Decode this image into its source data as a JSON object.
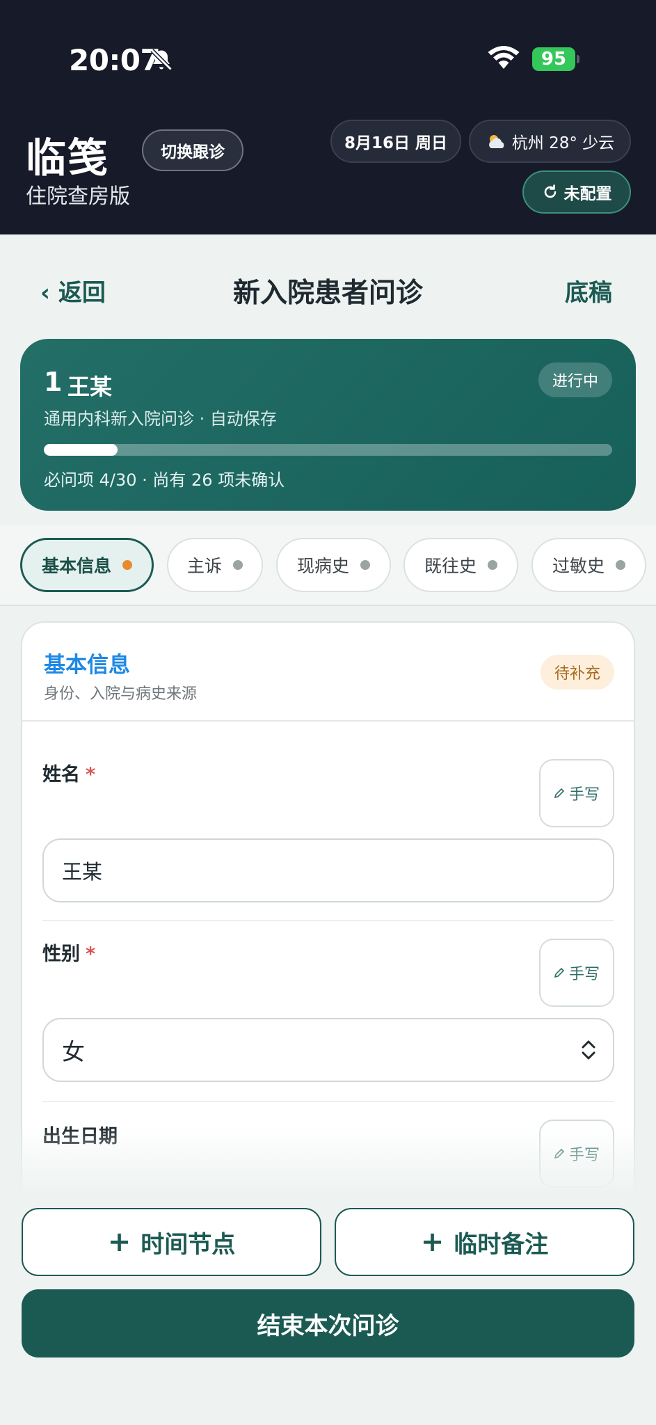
{
  "status_bar": {
    "time": "20:07",
    "battery": "95"
  },
  "header": {
    "brand": "临笺",
    "subtitle": "住院查房版",
    "switch_label": "切换跟诊",
    "date": "8月16日 周日",
    "weather": "杭州 28° 少云",
    "config_label": "未配置"
  },
  "nav": {
    "back": "‹ 返回",
    "title": "新入院患者问诊",
    "draft": "底稿"
  },
  "patient": {
    "number": "1",
    "name": "王某",
    "status": "进行中",
    "desc": "通用内科新入院问诊 · 自动保存",
    "progress_text": "必问项 4/30 · 尚有 26 项未确认",
    "progress": 0.13
  },
  "tabs": [
    {
      "label": "基本信息"
    },
    {
      "label": "主诉"
    },
    {
      "label": "现病史"
    },
    {
      "label": "既往史"
    },
    {
      "label": "过敏史"
    }
  ],
  "section": {
    "title": "基本信息",
    "subtitle": "身份、入院与病史来源",
    "badge": "待补充",
    "handwrite_label": "手写",
    "fields": [
      {
        "label": "姓名",
        "required": "*",
        "value": "王某"
      },
      {
        "label": "性别",
        "required": "*",
        "value": "女"
      },
      {
        "label": "出生日期"
      }
    ]
  },
  "actions": {
    "time_node": "时间节点",
    "temp_note": "临时备注",
    "finish": "结束本次问诊"
  },
  "colors": {
    "brand": "#1b5a52",
    "accent_blue": "#1e88e5",
    "pending_orange": "#e58b2e",
    "header_bg": "#161a29"
  },
  "icons": [
    "bell-slash-icon",
    "wifi-icon",
    "battery-icon",
    "cloud-sun-icon",
    "refresh-icon",
    "pencil-icon",
    "chevron-updown-icon",
    "plus-icon"
  ]
}
